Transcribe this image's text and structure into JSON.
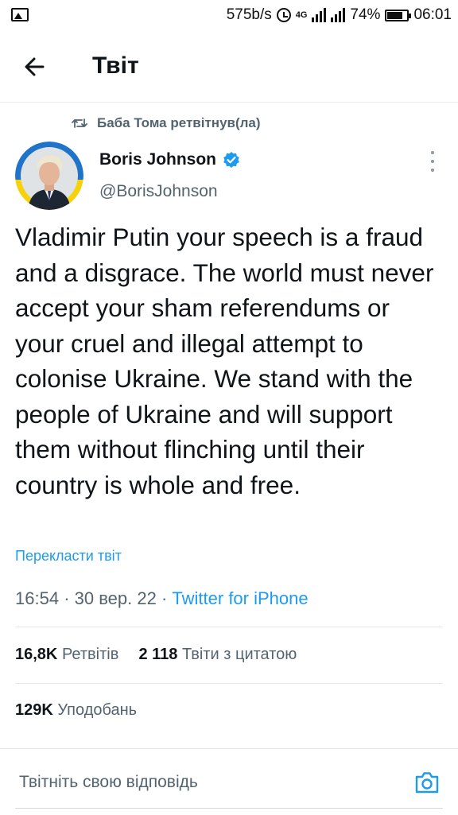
{
  "status_bar": {
    "speed": "575b/s",
    "network": "4G",
    "battery": "74%",
    "time": "06:01"
  },
  "header": {
    "title": "Твіт"
  },
  "retweet": {
    "text": "Баба Тома ретвітнув(ла)"
  },
  "author": {
    "name": "Boris Johnson",
    "handle": "@BorisJohnson",
    "verified": true
  },
  "tweet": {
    "text": "Vladimir Putin your speech is a fraud and a disgrace. The world must never accept your sham referendums or your cruel and illegal attempt to colonise Ukraine. We stand with the people of Ukraine and will support them without flinching until their country is whole and free.",
    "translate_label": "Перекласти твіт",
    "time": "16:54",
    "date": "30 вер. 22",
    "source": "Twitter for iPhone"
  },
  "stats": {
    "retweets": "16,8K",
    "retweets_label": "Ретвітів",
    "quotes": "2 118",
    "quotes_label": "Твіти з цитатою",
    "likes": "129K",
    "likes_label": "Уподобань"
  },
  "reply": {
    "placeholder": "Твітніть свою відповідь"
  },
  "colors": {
    "accent": "#1d9bf0",
    "secondary_text": "#536471",
    "primary_text": "#0f1419"
  }
}
